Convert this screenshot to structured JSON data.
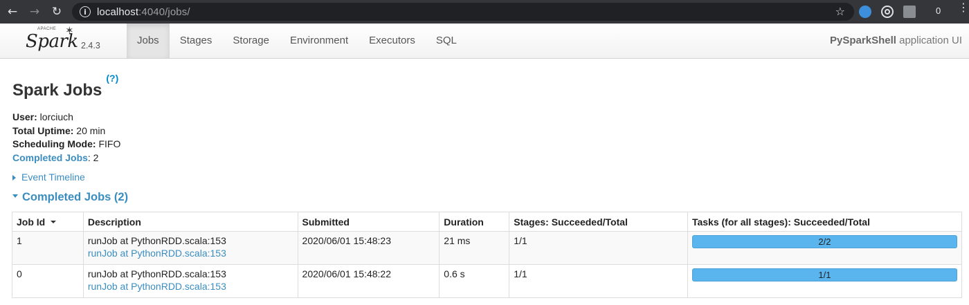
{
  "browser": {
    "url_host": "localhost",
    "url_path": ":4040/jobs/",
    "ext_count": "0",
    "icons": [
      "back-icon",
      "forward-icon",
      "reload-icon",
      "info-icon",
      "star-icon",
      "menu-icon"
    ]
  },
  "navbar": {
    "logo_apache": "APACHE",
    "logo_word": "Spark",
    "version": "2.4.3",
    "tabs": [
      "Jobs",
      "Stages",
      "Storage",
      "Environment",
      "Executors",
      "SQL"
    ],
    "active_tab": "Jobs",
    "app_name_bold": "PySparkShell",
    "app_name_rest": " application UI"
  },
  "page": {
    "title": "Spark Jobs",
    "help": "(?)",
    "user_label": "User:",
    "user_value": " lorciuch",
    "uptime_label": "Total Uptime:",
    "uptime_value": " 20 min",
    "mode_label": "Scheduling Mode:",
    "mode_value": " FIFO",
    "completed_label": "Completed Jobs",
    "completed_value": ": 2",
    "event_timeline": "Event Timeline",
    "section_title": "Completed Jobs (2)"
  },
  "table": {
    "headers": [
      "Job Id",
      "Description",
      "Submitted",
      "Duration",
      "Stages: Succeeded/Total",
      "Tasks (for all stages): Succeeded/Total"
    ],
    "rows": [
      {
        "id": "1",
        "desc": "runJob at PythonRDD.scala:153",
        "desc_link": "runJob at PythonRDD.scala:153",
        "submitted": "2020/06/01 15:48:23",
        "duration": "21 ms",
        "stages": "1/1",
        "tasks": "2/2",
        "progress": 1.0
      },
      {
        "id": "0",
        "desc": "runJob at PythonRDD.scala:153",
        "desc_link": "runJob at PythonRDD.scala:153",
        "submitted": "2020/06/01 15:48:22",
        "duration": "0.6 s",
        "stages": "1/1",
        "tasks": "1/1",
        "progress": 1.0
      }
    ]
  },
  "colors": {
    "chrome_bg": "#35363a",
    "link": "#3b8dc0",
    "progress_fill": "#5ab5ee"
  }
}
